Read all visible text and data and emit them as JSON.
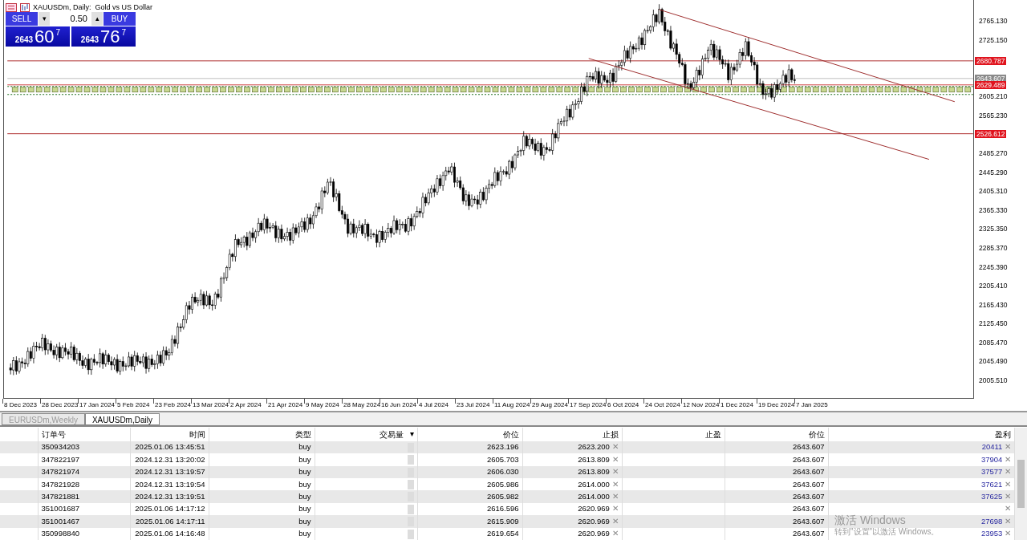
{
  "chart_window": {
    "title": "XAUUSDm, Daily:  Gold vs US Dollar"
  },
  "one_click_trading": {
    "sell_label": "SELL",
    "buy_label": "BUY",
    "volume": "0.50",
    "down_arrow": "▾",
    "up_arrow": "▴",
    "sell_price": {
      "big_figure": "2643",
      "pips": "60",
      "point": "7"
    },
    "buy_price": {
      "big_figure": "2643",
      "pips": "76",
      "point": "7"
    }
  },
  "price_axis": {
    "ticks": [
      "2765.130",
      "2725.150",
      "2605.210",
      "2565.230",
      "2485.270",
      "2445.290",
      "2405.310",
      "2365.330",
      "2325.350",
      "2285.370",
      "2245.390",
      "2205.410",
      "2165.430",
      "2125.450",
      "2085.470",
      "2045.490",
      "2005.510"
    ],
    "level_labels": [
      {
        "text": "2680.787",
        "kind": "red"
      },
      {
        "text": "2643.607",
        "kind": "bid"
      },
      {
        "text": "2629.489",
        "kind": "red"
      },
      {
        "text": "2526.612",
        "kind": "red"
      }
    ]
  },
  "time_axis": {
    "ticks": [
      "8 Dec 2023",
      "28 Dec 2023",
      "17 Jan 2024",
      "5 Feb 2024",
      "23 Feb 2024",
      "13 Mar 2024",
      "2 Apr 2024",
      "21 Apr 2024",
      "9 May 2024",
      "28 May 2024",
      "16 Jun 2024",
      "4 Jul 2024",
      "23 Jul 2024",
      "11 Aug 2024",
      "29 Aug 2024",
      "17 Sep 2024",
      "6 Oct 2024",
      "24 Oct 2024",
      "12 Nov 2024",
      "1 Dec 2024",
      "19 Dec 2024",
      "7 Jan 2025"
    ]
  },
  "chart_tabs": [
    {
      "label": "EURUSDm,Weekly",
      "selected": false
    },
    {
      "label": "XAUUSDm,Daily",
      "selected": true
    }
  ],
  "trade_table": {
    "columns": [
      "订单号",
      "时间",
      "类型",
      "交易量",
      "价位",
      "止损",
      "止盈",
      "价位",
      "盈利"
    ],
    "sort_marker": "▾",
    "close_mark": "✕",
    "rows": [
      {
        "order": "350934203",
        "time": "2025.01.06 13:45:51",
        "type": "buy",
        "open_price": "2623.196",
        "stop_loss": "2623.200",
        "current_price": "2643.607",
        "profit": "20411"
      },
      {
        "order": "347822197",
        "time": "2024.12.31 13:20:02",
        "type": "buy",
        "open_price": "2605.703",
        "stop_loss": "2613.809",
        "current_price": "2643.607",
        "profit": "37904"
      },
      {
        "order": "347821974",
        "time": "2024.12.31 13:19:57",
        "type": "buy",
        "open_price": "2606.030",
        "stop_loss": "2613.809",
        "current_price": "2643.607",
        "profit": "37577"
      },
      {
        "order": "347821928",
        "time": "2024.12.31 13:19:54",
        "type": "buy",
        "open_price": "2605.986",
        "stop_loss": "2614.000",
        "current_price": "2643.607",
        "profit": "37621"
      },
      {
        "order": "347821881",
        "time": "2024.12.31 13:19:51",
        "type": "buy",
        "open_price": "2605.982",
        "stop_loss": "2614.000",
        "current_price": "2643.607",
        "profit": "37625"
      },
      {
        "order": "351001687",
        "time": "2025.01.06 14:17:12",
        "type": "buy",
        "open_price": "2616.596",
        "stop_loss": "2620.969",
        "current_price": "2643.607"
      },
      {
        "order": "351001467",
        "time": "2025.01.06 14:17:11",
        "type": "buy",
        "open_price": "2615.909",
        "stop_loss": "2620.969",
        "current_price": "2643.607",
        "profit": "27698"
      },
      {
        "order": "350998840",
        "time": "2025.01.06 14:16:48",
        "type": "buy",
        "open_price": "2619.654",
        "stop_loss": "2620.969",
        "current_price": "2643.607",
        "profit": "23953"
      }
    ]
  },
  "os_notice": {
    "title": "激活 Windows",
    "text": "转到\"设置\"以激活 Windows。"
  }
}
